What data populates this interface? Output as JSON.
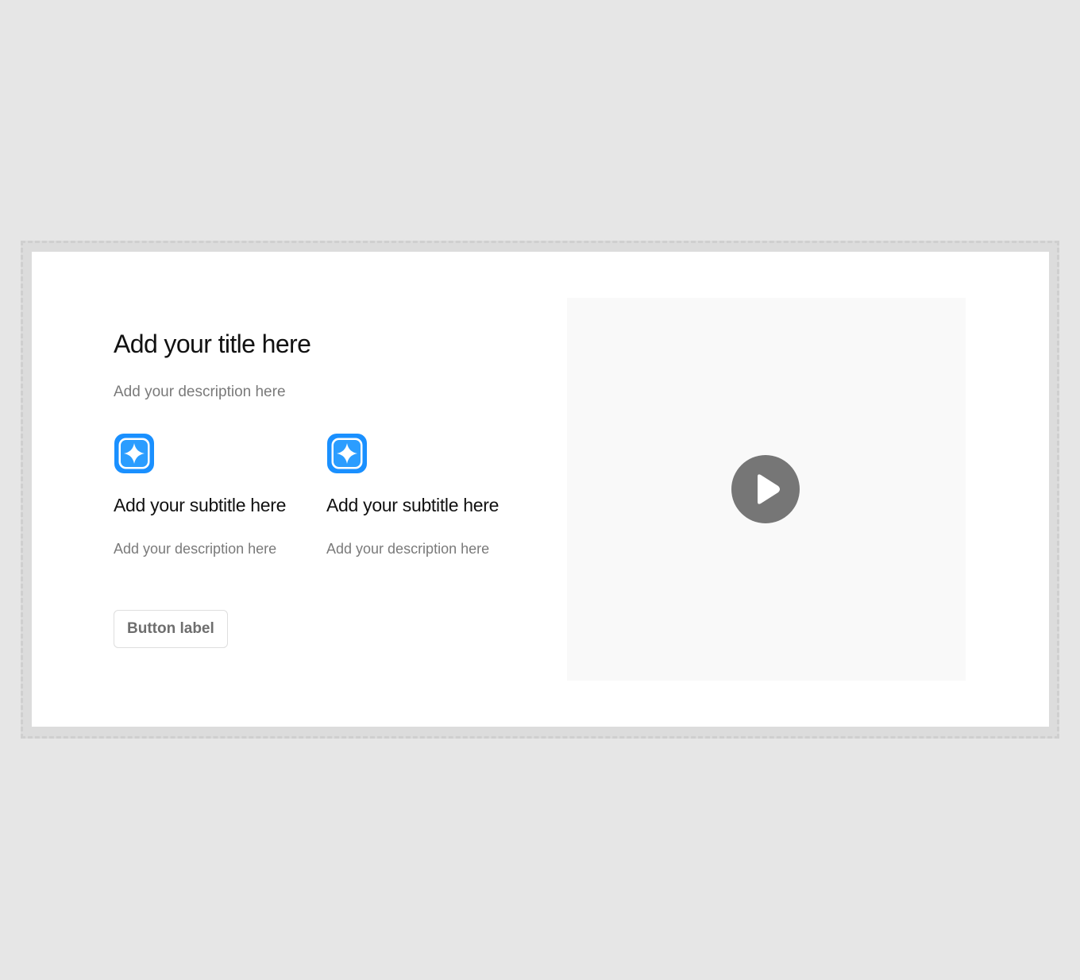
{
  "hero": {
    "title": "Add your title here",
    "description": "Add your description here"
  },
  "features": [
    {
      "icon": "sparkle-icon",
      "title": "Add your subtitle here",
      "description": "Add your description here"
    },
    {
      "icon": "sparkle-icon",
      "title": "Add your subtitle here",
      "description": "Add your description here"
    }
  ],
  "button": {
    "label": "Button label"
  },
  "video": {
    "icon": "play-icon"
  },
  "colors": {
    "page_background": "#e6e6e6",
    "section_background": "#ffffff",
    "video_placeholder": "#f9f9f9",
    "icon_blue": "#1a90ff",
    "play_button": "#767676",
    "muted_text": "#7a7a7a"
  }
}
